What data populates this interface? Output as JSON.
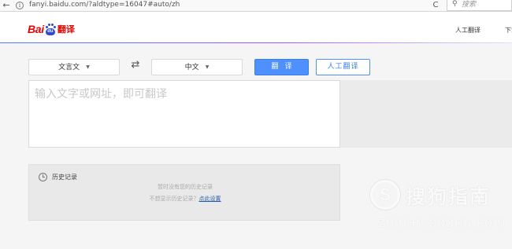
{
  "browser": {
    "url": "fanyi.baidu.com/?aldtype=16047#auto/zh",
    "search_placeholder": "搜索",
    "back_glyph": "←",
    "info_glyph": "i",
    "reload_glyph": "C",
    "search_glyph": "🔍"
  },
  "header": {
    "logo_text_bai": "Bai",
    "logo_text_du": "du",
    "logo_text_fanyi": "翻译",
    "logo_color": "#e10601",
    "paw_color": "#2c4ad3",
    "nav_human_translation": "人工翻译",
    "nav_download": "下载"
  },
  "controls": {
    "source_language": "文言文",
    "target_language": "中文",
    "caret_glyph": "▼",
    "swap_glyph": "⇄",
    "translate_button": "翻译",
    "human_translate_button": "人工翻译",
    "accent_color": "#4d90fe"
  },
  "input": {
    "placeholder": "输入文字或网址，即可翻译"
  },
  "history": {
    "title": "历史记录",
    "empty_text": "暂时没有您的历史记录",
    "hint_prefix": "不想显示历史记录？",
    "hint_link": "点此设置"
  },
  "watermark": {
    "cn": "搜狗指南",
    "en": "zhinan.sogou.com"
  }
}
